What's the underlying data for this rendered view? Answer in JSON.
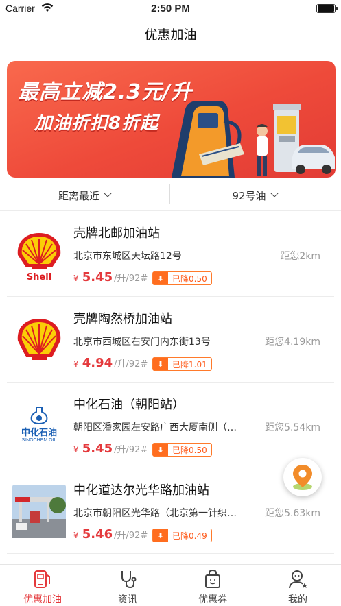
{
  "status_bar": {
    "carrier": "Carrier",
    "time": "2:50 PM"
  },
  "nav": {
    "title": "优惠加油"
  },
  "banner": {
    "line1": "最高立减2.3元/升",
    "line2": "加油折扣8折起"
  },
  "filters": [
    {
      "label": "距离最近"
    },
    {
      "label": "92号油"
    }
  ],
  "stations": [
    {
      "name": "壳牌北邮加油站",
      "address": "北京市东城区天坛路12号",
      "distance": "距您2km",
      "yen": "¥",
      "price": "5.45",
      "unit": "/升/92#",
      "discount": "已降0.50",
      "logo": "shell-logo-icon"
    },
    {
      "name": "壳牌陶然桥加油站",
      "address": "北京市西城区右安门内东街13号",
      "distance": "距您4.19km",
      "yen": "¥",
      "price": "4.94",
      "unit": "/升/92#",
      "discount": "已降1.01",
      "logo": "shell-logo-icon"
    },
    {
      "name": "中化石油（朝阳站）",
      "address": "朝阳区潘家园左安路广西大厦南侧（…",
      "distance": "距您5.54km",
      "yen": "¥",
      "price": "5.45",
      "unit": "/升/92#",
      "discount": "已降0.50",
      "logo": "sinochem-logo-icon",
      "logo_text": "中化石油",
      "logo_subtext": "SINOCHEM OIL"
    },
    {
      "name": "中化道达尔光华路加油站",
      "address": "北京市朝阳区光华路（北京第一针织…",
      "distance": "距您5.63km",
      "yen": "¥",
      "price": "5.46",
      "unit": "/升/92#",
      "discount": "已降0.49",
      "logo": "station-photo"
    }
  ],
  "tabs": [
    {
      "label": "优惠加油",
      "icon": "fuel-phone-icon",
      "active": true
    },
    {
      "label": "资讯",
      "icon": "stethoscope-icon",
      "active": false
    },
    {
      "label": "优惠券",
      "icon": "coupon-bag-icon",
      "active": false
    },
    {
      "label": "我的",
      "icon": "user-star-icon",
      "active": false
    }
  ],
  "colors": {
    "accent": "#e4393c",
    "discount": "#ff6d1f",
    "banner": "#ee4a3a"
  }
}
